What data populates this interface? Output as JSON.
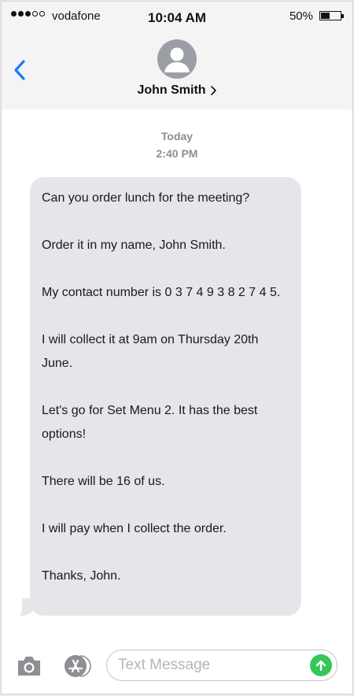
{
  "status_bar": {
    "carrier": "vodafone",
    "time": "10:04 AM",
    "battery_percent": "50%",
    "battery_level": 0.5,
    "signal_bars_filled": 3,
    "signal_bars_total": 5
  },
  "header": {
    "contact_name": "John Smith",
    "back_icon": "chevron-left-icon",
    "disclosure_icon": "chevron-right-icon",
    "avatar_icon": "person-silhouette"
  },
  "conversation": {
    "day": "Today",
    "time": "2:40 PM",
    "message": {
      "paragraphs": [
        "Can you order lunch for the meeting?",
        "Order it in my name, John Smith.",
        "My contact number is 0 3 7 4 9 3 8 2 7 4 5.",
        "I will collect it at 9am on Thursday 20th June.",
        "Let's go for Set Menu 2. It has the best options!",
        "There will be 16 of us.",
        "I will pay when I collect the order.",
        "Thanks, John."
      ]
    }
  },
  "input_bar": {
    "placeholder": "Text Message",
    "value": "",
    "camera_icon": "camera-icon",
    "apps_icon": "app-store-icon",
    "send_icon": "arrow-up-icon"
  },
  "colors": {
    "accent_blue": "#1a7cf5",
    "bubble_gray": "#e5e5ea",
    "send_green": "#34c759",
    "header_bg": "#f4f4f4",
    "timestamp_gray": "#8e8e93"
  }
}
